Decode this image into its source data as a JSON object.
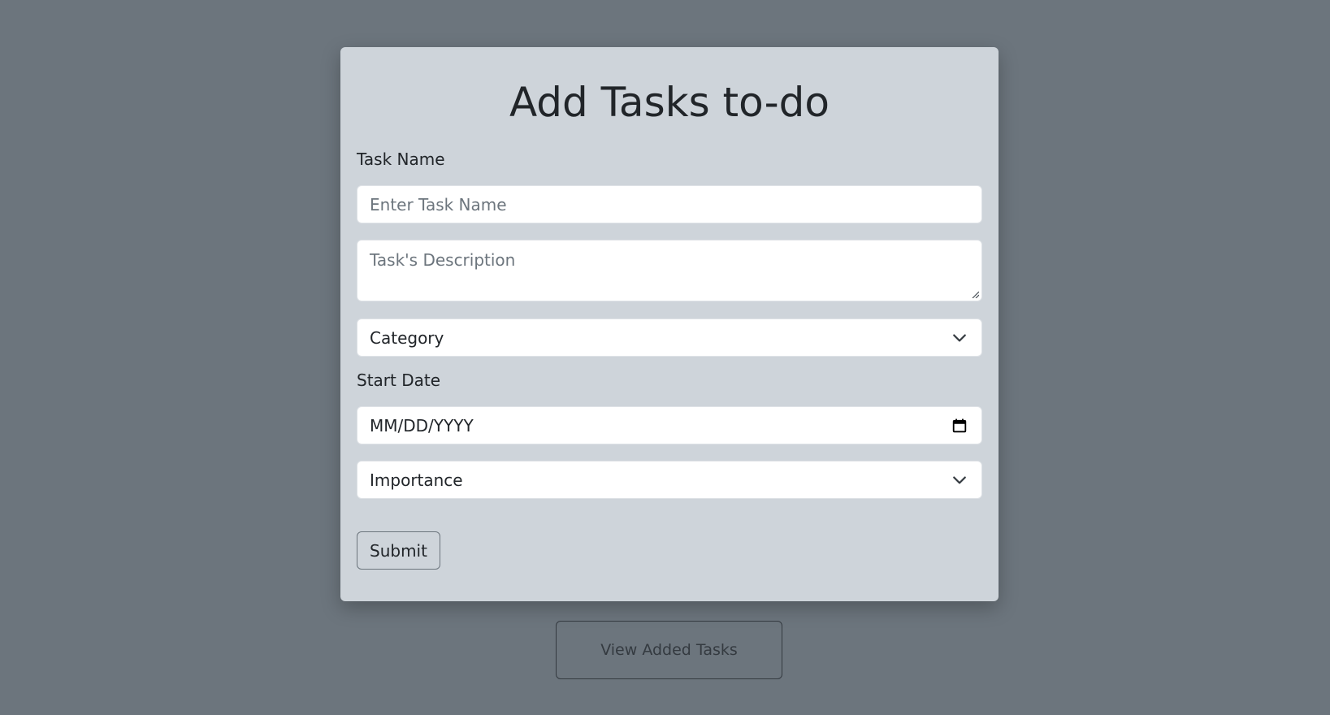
{
  "form": {
    "title": "Add Tasks to-do",
    "task_name_label": "Task Name",
    "task_name_placeholder": "Enter Task Name",
    "description_placeholder": "Task's Description",
    "category_selected": "Category",
    "start_date_label": "Start Date",
    "start_date_value": "MM/DD/YYYY",
    "importance_selected": "Importance",
    "submit_label": "Submit"
  },
  "footer": {
    "view_tasks_label": "View Added Tasks"
  },
  "colors": {
    "page_background": "#6c757d",
    "card_background": "#ced4da",
    "input_background": "#ffffff",
    "text": "#212529",
    "placeholder": "#6c757d"
  },
  "icons": {
    "select": "chevron-down-icon",
    "date": "calendar-icon",
    "textarea": "resize-handle-icon"
  }
}
